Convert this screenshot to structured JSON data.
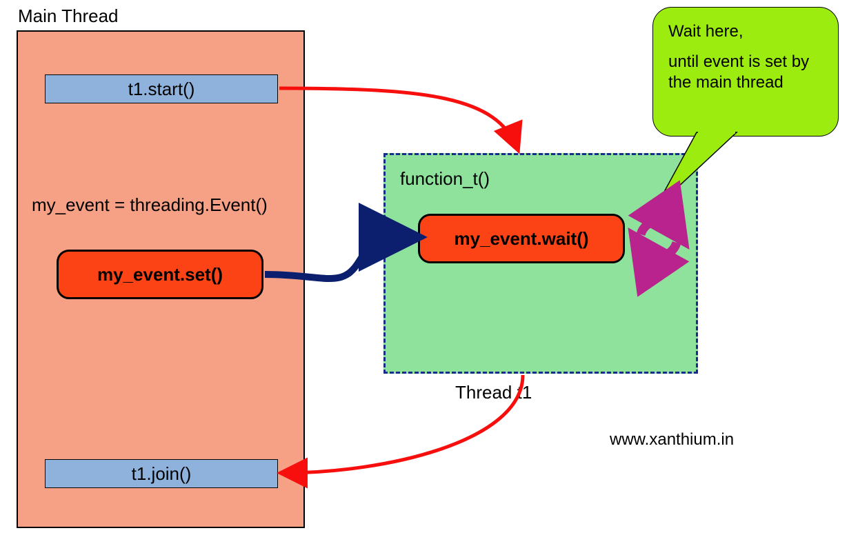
{
  "mainThread": {
    "label": "Main Thread",
    "eventDeclaration": "my_event = threading.Event()",
    "startCall": "t1.start()",
    "joinCall": "t1.join()",
    "setCall": "my_event.set()"
  },
  "workerThread": {
    "functionLabel": "function_t()",
    "waitCall": "my_event.wait()",
    "threadLabel": "Thread t1"
  },
  "callout": {
    "line1": "Wait here,",
    "line2": "until event is set by the main thread"
  },
  "website": "www.xanthium.in",
  "colors": {
    "mainBox": "#f6a085",
    "blueBox": "#8fb2dc",
    "orangeBox": "#fb4316",
    "greenBox": "#8ee29c",
    "callout": "#9dec10",
    "redArrow": "#f60f0c",
    "navyArrow": "#0b1f6e",
    "spinner": "#b8238e"
  },
  "icons": {
    "spinner": "sync-icon"
  }
}
